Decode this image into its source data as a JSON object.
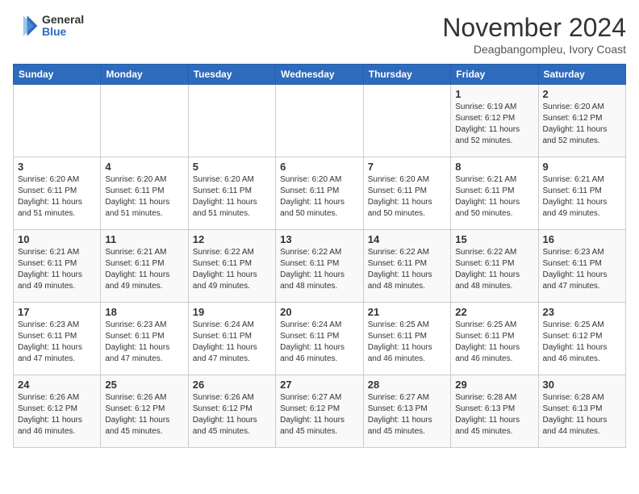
{
  "header": {
    "logo_general": "General",
    "logo_blue": "Blue",
    "month_title": "November 2024",
    "location": "Deagbangompleu, Ivory Coast"
  },
  "calendar": {
    "days_of_week": [
      "Sunday",
      "Monday",
      "Tuesday",
      "Wednesday",
      "Thursday",
      "Friday",
      "Saturday"
    ],
    "weeks": [
      [
        {
          "day": "",
          "info": ""
        },
        {
          "day": "",
          "info": ""
        },
        {
          "day": "",
          "info": ""
        },
        {
          "day": "",
          "info": ""
        },
        {
          "day": "",
          "info": ""
        },
        {
          "day": "1",
          "info": "Sunrise: 6:19 AM\nSunset: 6:12 PM\nDaylight: 11 hours and 52 minutes."
        },
        {
          "day": "2",
          "info": "Sunrise: 6:20 AM\nSunset: 6:12 PM\nDaylight: 11 hours and 52 minutes."
        }
      ],
      [
        {
          "day": "3",
          "info": "Sunrise: 6:20 AM\nSunset: 6:11 PM\nDaylight: 11 hours and 51 minutes."
        },
        {
          "day": "4",
          "info": "Sunrise: 6:20 AM\nSunset: 6:11 PM\nDaylight: 11 hours and 51 minutes."
        },
        {
          "day": "5",
          "info": "Sunrise: 6:20 AM\nSunset: 6:11 PM\nDaylight: 11 hours and 51 minutes."
        },
        {
          "day": "6",
          "info": "Sunrise: 6:20 AM\nSunset: 6:11 PM\nDaylight: 11 hours and 50 minutes."
        },
        {
          "day": "7",
          "info": "Sunrise: 6:20 AM\nSunset: 6:11 PM\nDaylight: 11 hours and 50 minutes."
        },
        {
          "day": "8",
          "info": "Sunrise: 6:21 AM\nSunset: 6:11 PM\nDaylight: 11 hours and 50 minutes."
        },
        {
          "day": "9",
          "info": "Sunrise: 6:21 AM\nSunset: 6:11 PM\nDaylight: 11 hours and 49 minutes."
        }
      ],
      [
        {
          "day": "10",
          "info": "Sunrise: 6:21 AM\nSunset: 6:11 PM\nDaylight: 11 hours and 49 minutes."
        },
        {
          "day": "11",
          "info": "Sunrise: 6:21 AM\nSunset: 6:11 PM\nDaylight: 11 hours and 49 minutes."
        },
        {
          "day": "12",
          "info": "Sunrise: 6:22 AM\nSunset: 6:11 PM\nDaylight: 11 hours and 49 minutes."
        },
        {
          "day": "13",
          "info": "Sunrise: 6:22 AM\nSunset: 6:11 PM\nDaylight: 11 hours and 48 minutes."
        },
        {
          "day": "14",
          "info": "Sunrise: 6:22 AM\nSunset: 6:11 PM\nDaylight: 11 hours and 48 minutes."
        },
        {
          "day": "15",
          "info": "Sunrise: 6:22 AM\nSunset: 6:11 PM\nDaylight: 11 hours and 48 minutes."
        },
        {
          "day": "16",
          "info": "Sunrise: 6:23 AM\nSunset: 6:11 PM\nDaylight: 11 hours and 47 minutes."
        }
      ],
      [
        {
          "day": "17",
          "info": "Sunrise: 6:23 AM\nSunset: 6:11 PM\nDaylight: 11 hours and 47 minutes."
        },
        {
          "day": "18",
          "info": "Sunrise: 6:23 AM\nSunset: 6:11 PM\nDaylight: 11 hours and 47 minutes."
        },
        {
          "day": "19",
          "info": "Sunrise: 6:24 AM\nSunset: 6:11 PM\nDaylight: 11 hours and 47 minutes."
        },
        {
          "day": "20",
          "info": "Sunrise: 6:24 AM\nSunset: 6:11 PM\nDaylight: 11 hours and 46 minutes."
        },
        {
          "day": "21",
          "info": "Sunrise: 6:25 AM\nSunset: 6:11 PM\nDaylight: 11 hours and 46 minutes."
        },
        {
          "day": "22",
          "info": "Sunrise: 6:25 AM\nSunset: 6:11 PM\nDaylight: 11 hours and 46 minutes."
        },
        {
          "day": "23",
          "info": "Sunrise: 6:25 AM\nSunset: 6:12 PM\nDaylight: 11 hours and 46 minutes."
        }
      ],
      [
        {
          "day": "24",
          "info": "Sunrise: 6:26 AM\nSunset: 6:12 PM\nDaylight: 11 hours and 46 minutes."
        },
        {
          "day": "25",
          "info": "Sunrise: 6:26 AM\nSunset: 6:12 PM\nDaylight: 11 hours and 45 minutes."
        },
        {
          "day": "26",
          "info": "Sunrise: 6:26 AM\nSunset: 6:12 PM\nDaylight: 11 hours and 45 minutes."
        },
        {
          "day": "27",
          "info": "Sunrise: 6:27 AM\nSunset: 6:12 PM\nDaylight: 11 hours and 45 minutes."
        },
        {
          "day": "28",
          "info": "Sunrise: 6:27 AM\nSunset: 6:13 PM\nDaylight: 11 hours and 45 minutes."
        },
        {
          "day": "29",
          "info": "Sunrise: 6:28 AM\nSunset: 6:13 PM\nDaylight: 11 hours and 45 minutes."
        },
        {
          "day": "30",
          "info": "Sunrise: 6:28 AM\nSunset: 6:13 PM\nDaylight: 11 hours and 44 minutes."
        }
      ]
    ]
  }
}
